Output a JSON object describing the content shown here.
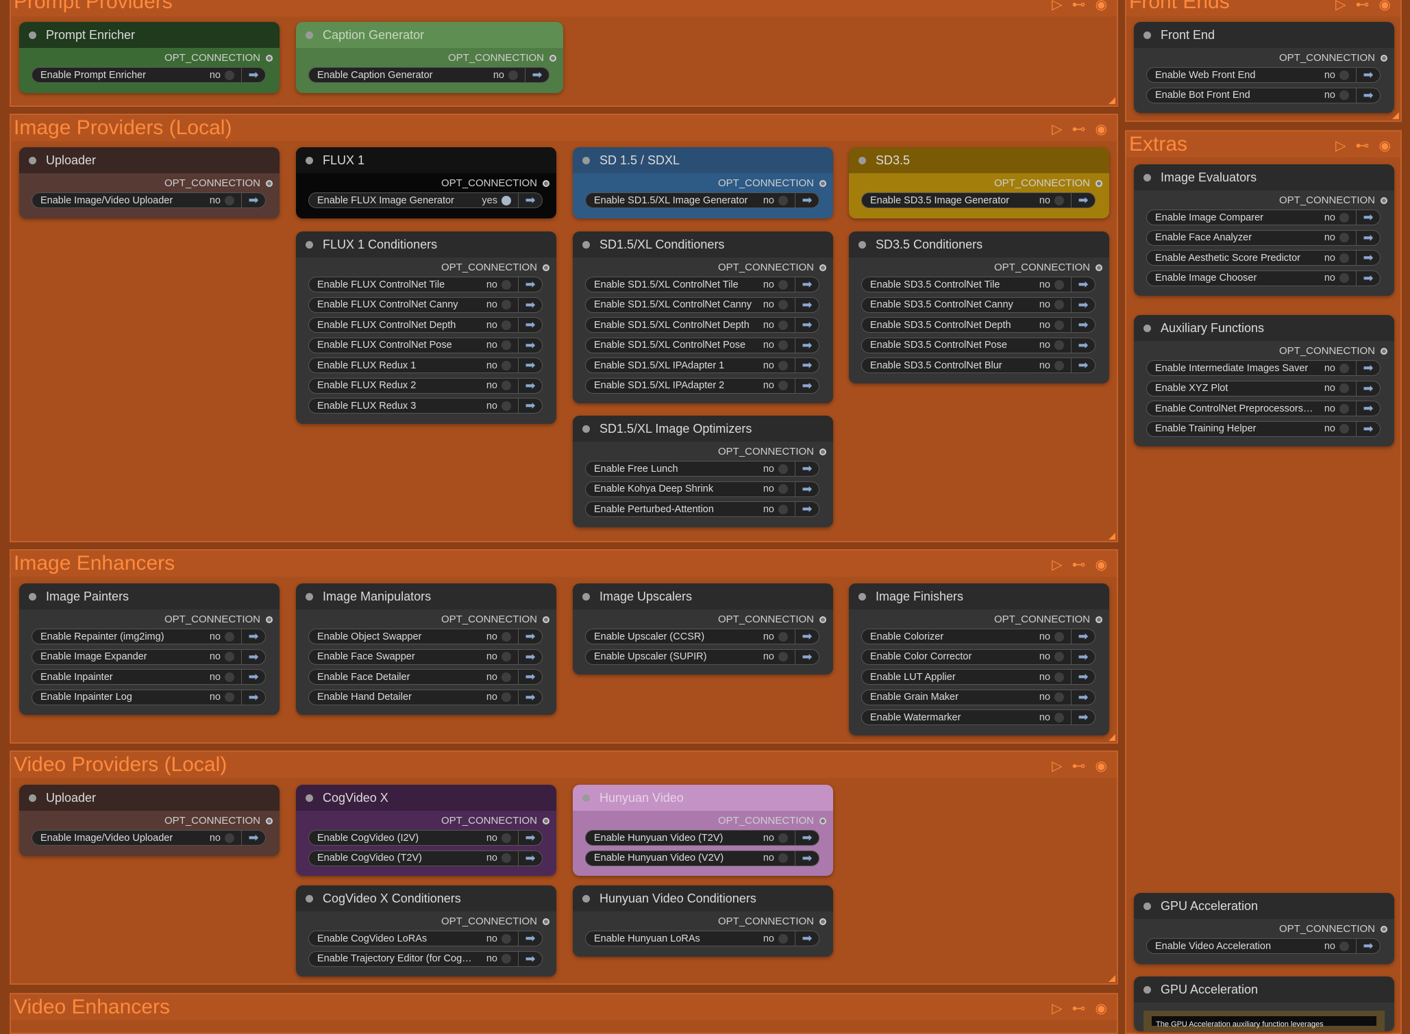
{
  "opt_label": "OPT_CONNECTION",
  "groups": {
    "prompt_providers": {
      "title": "Prompt Providers"
    },
    "image_providers": {
      "title": "Image Providers (Local)"
    },
    "image_enhancers": {
      "title": "Image Enhancers"
    },
    "video_providers": {
      "title": "Video Providers (Local)"
    },
    "video_enhancers": {
      "title": "Video Enhancers"
    },
    "front_ends": {
      "title": "Front Ends"
    },
    "extras": {
      "title": "Extras"
    }
  },
  "nodes": {
    "prompt_enricher": {
      "title": "Prompt Enricher",
      "widgets": [
        {
          "label": "Enable Prompt Enricher",
          "value": "no"
        }
      ]
    },
    "caption_generator": {
      "title": "Caption Generator",
      "widgets": [
        {
          "label": "Enable Caption Generator",
          "value": "no"
        }
      ]
    },
    "front_end": {
      "title": "Front End",
      "widgets": [
        {
          "label": "Enable Web Front End",
          "value": "no"
        },
        {
          "label": "Enable Bot Front End",
          "value": "no"
        }
      ]
    },
    "uploader_img": {
      "title": "Uploader",
      "widgets": [
        {
          "label": "Enable Image/Video Uploader",
          "value": "no"
        }
      ]
    },
    "flux1": {
      "title": "FLUX 1",
      "widgets": [
        {
          "label": "Enable FLUX Image Generator",
          "value": "yes"
        }
      ]
    },
    "sd15": {
      "title": "SD 1.5 / SDXL",
      "widgets": [
        {
          "label": "Enable SD1.5/XL Image Generator",
          "value": "no"
        }
      ]
    },
    "sd35": {
      "title": "SD3.5",
      "widgets": [
        {
          "label": "Enable SD3.5 Image Generator",
          "value": "no"
        }
      ]
    },
    "flux1_cond": {
      "title": "FLUX 1 Conditioners",
      "widgets": [
        {
          "label": "Enable FLUX ControlNet Tile",
          "value": "no"
        },
        {
          "label": "Enable FLUX ControlNet Canny",
          "value": "no"
        },
        {
          "label": "Enable FLUX ControlNet Depth",
          "value": "no"
        },
        {
          "label": "Enable FLUX ControlNet Pose",
          "value": "no"
        },
        {
          "label": "Enable FLUX Redux 1",
          "value": "no"
        },
        {
          "label": "Enable FLUX Redux 2",
          "value": "no"
        },
        {
          "label": "Enable FLUX Redux 3",
          "value": "no"
        }
      ]
    },
    "sd15_cond": {
      "title": "SD1.5/XL Conditioners",
      "widgets": [
        {
          "label": "Enable SD1.5/XL ControlNet Tile",
          "value": "no"
        },
        {
          "label": "Enable SD1.5/XL ControlNet Canny",
          "value": "no"
        },
        {
          "label": "Enable SD1.5/XL ControlNet Depth",
          "value": "no"
        },
        {
          "label": "Enable SD1.5/XL ControlNet Pose",
          "value": "no"
        },
        {
          "label": "Enable SD1.5/XL IPAdapter 1",
          "value": "no"
        },
        {
          "label": "Enable SD1.5/XL IPAdapter 2",
          "value": "no"
        }
      ]
    },
    "sd35_cond": {
      "title": "SD3.5 Conditioners",
      "widgets": [
        {
          "label": "Enable SD3.5 ControlNet Tile",
          "value": "no"
        },
        {
          "label": "Enable SD3.5 ControlNet Canny",
          "value": "no"
        },
        {
          "label": "Enable SD3.5 ControlNet Depth",
          "value": "no"
        },
        {
          "label": "Enable SD3.5 ControlNet Pose",
          "value": "no"
        },
        {
          "label": "Enable SD3.5 ControlNet Blur",
          "value": "no"
        }
      ]
    },
    "sd15_opt": {
      "title": "SD1.5/XL Image Optimizers",
      "widgets": [
        {
          "label": "Enable Free Lunch",
          "value": "no"
        },
        {
          "label": "Enable Kohya Deep Shrink",
          "value": "no"
        },
        {
          "label": "Enable Perturbed-Attention",
          "value": "no"
        }
      ]
    },
    "image_evaluators": {
      "title": "Image Evaluators",
      "widgets": [
        {
          "label": "Enable Image Comparer",
          "value": "no"
        },
        {
          "label": "Enable Face Analyzer",
          "value": "no"
        },
        {
          "label": "Enable Aesthetic Score Predictor",
          "value": "no"
        },
        {
          "label": "Enable Image Chooser",
          "value": "no"
        }
      ]
    },
    "aux_functions": {
      "title": "Auxiliary Functions",
      "widgets": [
        {
          "label": "Enable Intermediate Images Saver",
          "value": "no"
        },
        {
          "label": "Enable XYZ Plot",
          "value": "no"
        },
        {
          "label": "Enable ControlNet Preprocessors…",
          "value": "no"
        },
        {
          "label": "Enable Training Helper",
          "value": "no"
        }
      ]
    },
    "image_painters": {
      "title": "Image Painters",
      "widgets": [
        {
          "label": "Enable Repainter (img2img)",
          "value": "no"
        },
        {
          "label": "Enable Image Expander",
          "value": "no"
        },
        {
          "label": "Enable Inpainter",
          "value": "no"
        },
        {
          "label": "Enable Inpainter Log",
          "value": "no"
        }
      ]
    },
    "image_manipulators": {
      "title": "Image Manipulators",
      "widgets": [
        {
          "label": "Enable Object Swapper",
          "value": "no"
        },
        {
          "label": "Enable Face Swapper",
          "value": "no"
        },
        {
          "label": "Enable Face Detailer",
          "value": "no"
        },
        {
          "label": "Enable Hand Detailer",
          "value": "no"
        }
      ]
    },
    "image_upscalers": {
      "title": "Image Upscalers",
      "widgets": [
        {
          "label": "Enable Upscaler (CCSR)",
          "value": "no"
        },
        {
          "label": "Enable Upscaler (SUPIR)",
          "value": "no"
        }
      ]
    },
    "image_finishers": {
      "title": "Image Finishers",
      "widgets": [
        {
          "label": "Enable Colorizer",
          "value": "no"
        },
        {
          "label": "Enable Color Corrector",
          "value": "no"
        },
        {
          "label": "Enable LUT Applier",
          "value": "no"
        },
        {
          "label": "Enable Grain Maker",
          "value": "no"
        },
        {
          "label": "Enable Watermarker",
          "value": "no"
        }
      ]
    },
    "uploader_vid": {
      "title": "Uploader",
      "widgets": [
        {
          "label": "Enable Image/Video Uploader",
          "value": "no"
        }
      ]
    },
    "cogvideo": {
      "title": "CogVideo X",
      "widgets": [
        {
          "label": "Enable CogVideo (I2V)",
          "value": "no"
        },
        {
          "label": "Enable CogVideo (T2V)",
          "value": "no"
        }
      ]
    },
    "hunyuan": {
      "title": "Hunyuan Video",
      "widgets": [
        {
          "label": "Enable Hunyuan Video (T2V)",
          "value": "no"
        },
        {
          "label": "Enable Hunyuan Video (V2V)",
          "value": "no"
        }
      ]
    },
    "cogvideo_cond": {
      "title": "CogVideo X Conditioners",
      "widgets": [
        {
          "label": "Enable CogVideo LoRAs",
          "value": "no"
        },
        {
          "label": "Enable Trajectory Editor (for Cog…",
          "value": "no"
        }
      ]
    },
    "hunyuan_cond": {
      "title": "Hunyuan Video Conditioners",
      "widgets": [
        {
          "label": "Enable Hunyuan LoRAs",
          "value": "no"
        }
      ]
    },
    "gpu_accel": {
      "title": "GPU Acceleration",
      "widgets": [
        {
          "label": "Enable Video Acceleration",
          "value": "no"
        }
      ]
    },
    "gpu_accel_note": {
      "title": "GPU Acceleration",
      "text": "The GPU Acceleration auxiliary function leverages"
    }
  }
}
